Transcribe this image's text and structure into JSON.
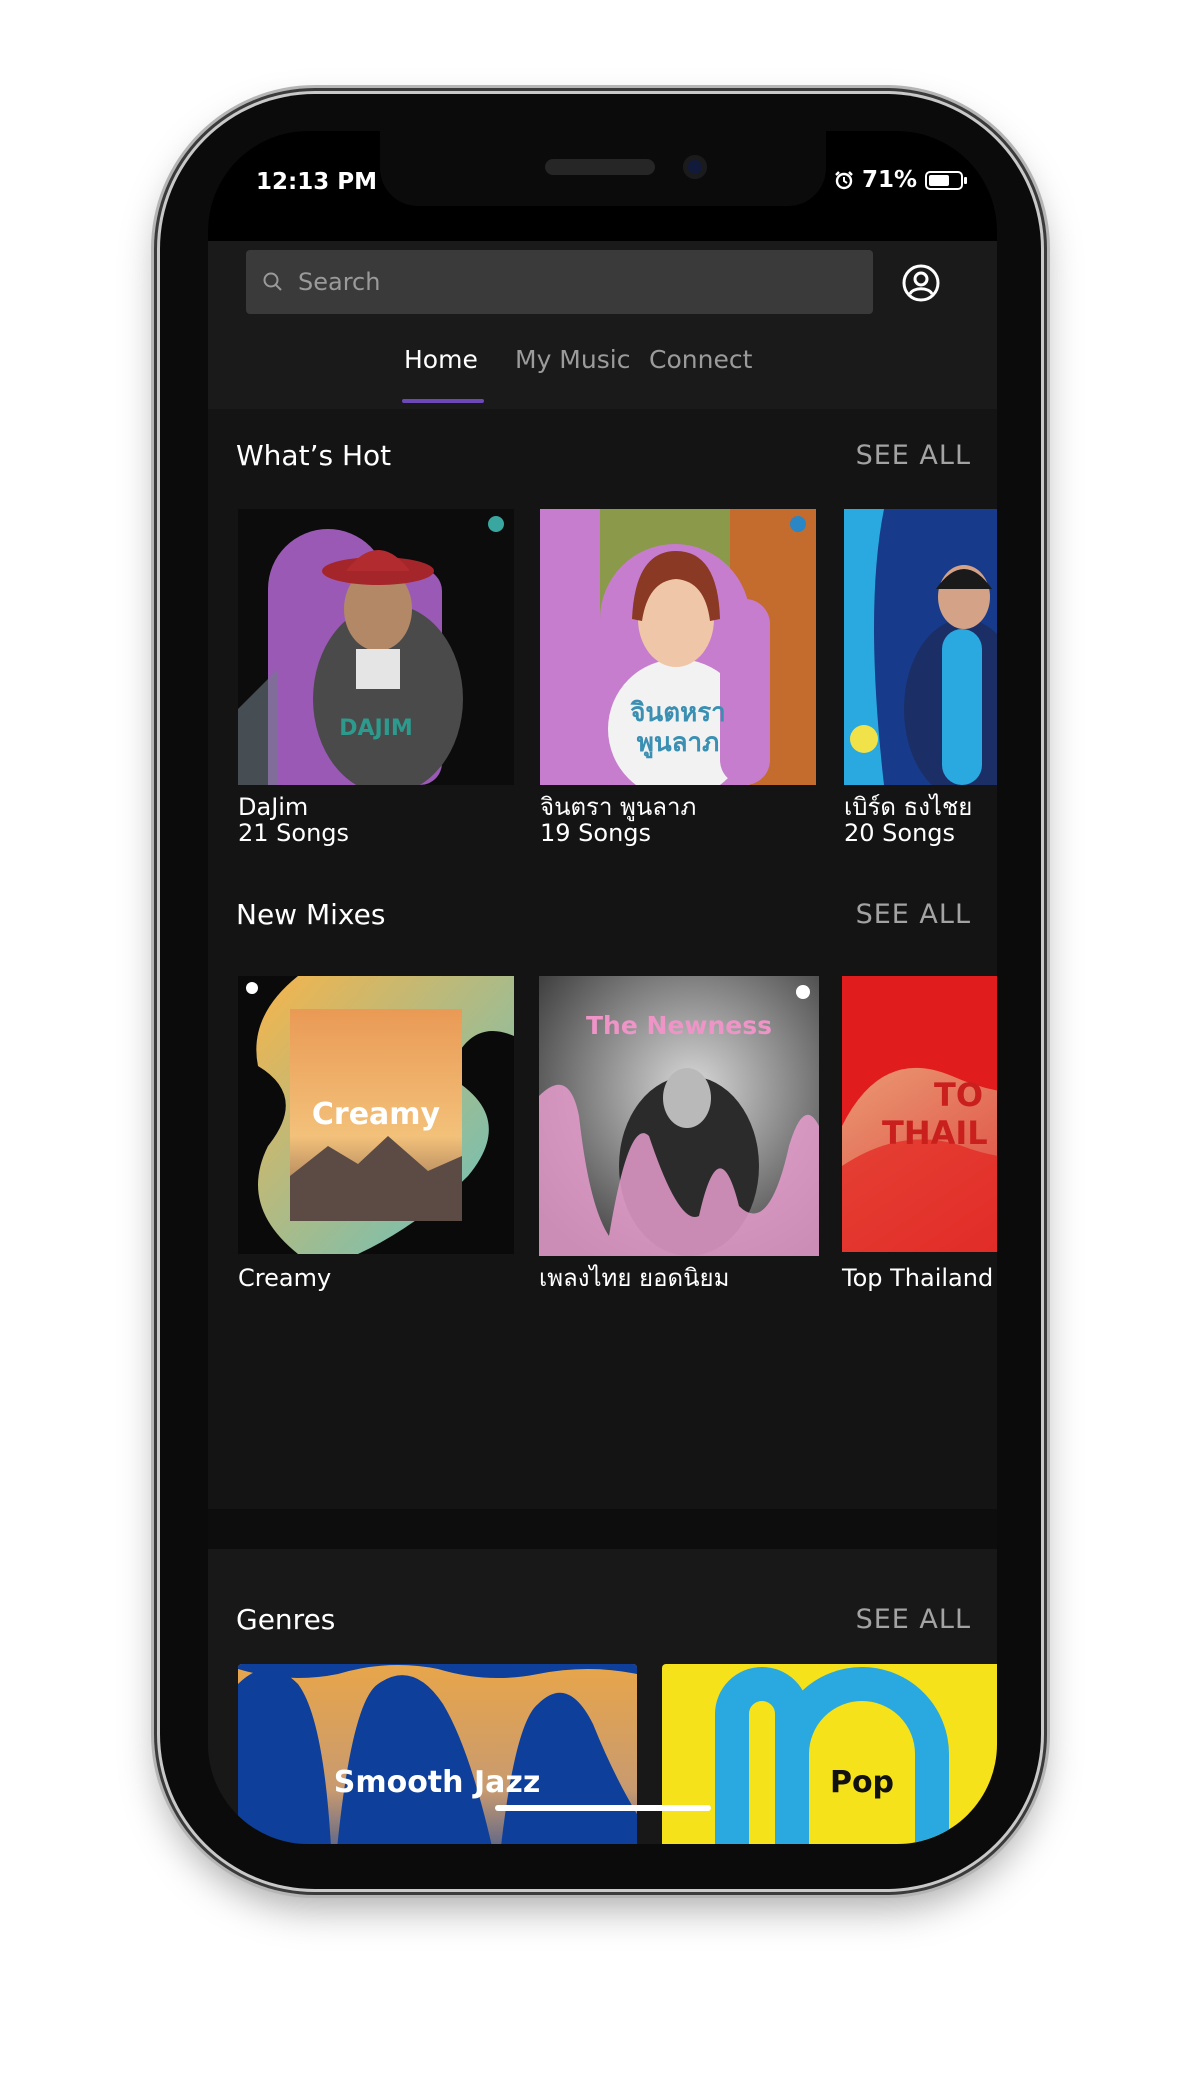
{
  "status": {
    "time": "12:13 PM",
    "battery": "71%",
    "battery_level": 0.71
  },
  "search": {
    "placeholder": "Search"
  },
  "tabs": [
    {
      "label": "Home",
      "active": true
    },
    {
      "label": "My Music",
      "active": false
    },
    {
      "label": "Connect",
      "active": false
    }
  ],
  "sections": {
    "whats_hot": {
      "title": "What’s Hot",
      "see_all": "SEE ALL",
      "items": [
        {
          "title": "DaJim",
          "songs": "21 Songs",
          "cover_text": "DAJIM"
        },
        {
          "title": "จินตรา พูนลาภ",
          "songs": "19 Songs",
          "cover_text_line1": "จินตหรา",
          "cover_text_line2": "พูนลาภ"
        },
        {
          "title": "เบิร์ด ธงไชย",
          "songs": "20 Songs"
        }
      ]
    },
    "new_mixes": {
      "title": "New Mixes",
      "see_all": "SEE ALL",
      "items": [
        {
          "title": "Creamy",
          "cover_text": "Creamy"
        },
        {
          "title": "เพลงไทย ยอดนิยม",
          "cover_text": "The Newness"
        },
        {
          "title": "Top Thailand",
          "cover_text_line1": "TO",
          "cover_text_line2": "THAIL"
        }
      ]
    },
    "genres": {
      "title": "Genres",
      "see_all": "SEE ALL",
      "items": [
        {
          "label": "Smooth Jazz"
        },
        {
          "label": "Pop"
        }
      ]
    }
  },
  "colors": {
    "accent": "#6d49b8",
    "background": "#141414",
    "cover_purple": "#9b59b6",
    "cover_pink": "#c77dce",
    "cover_blue": "#2aa9e0",
    "jazz_blue": "#0e3f9a",
    "pop_yellow": "#f5e21a"
  }
}
